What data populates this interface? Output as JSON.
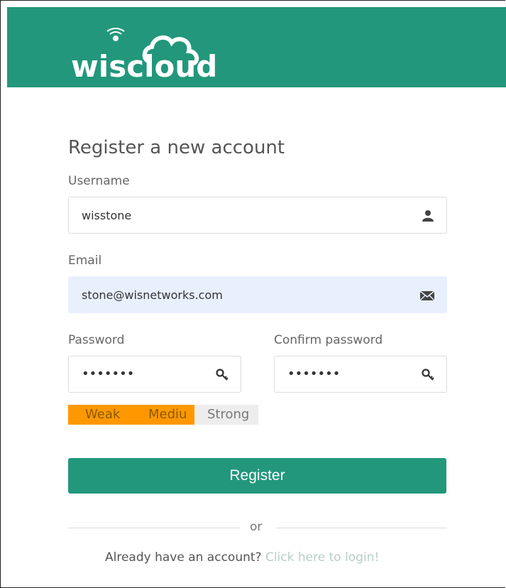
{
  "brand": {
    "logo_text": "wiscloud"
  },
  "form": {
    "title": "Register a new account",
    "username": {
      "label": "Username",
      "value": "wisstone",
      "icon": "user-icon"
    },
    "email": {
      "label": "Email",
      "value": "stone@wisnetworks.com",
      "icon": "envelope-icon"
    },
    "password": {
      "label": "Password",
      "value": "•••••••",
      "icon": "key-icon"
    },
    "confirm_password": {
      "label": "Confirm password",
      "value": "•••••••",
      "icon": "key-icon"
    },
    "strength": {
      "labels": [
        "Weak",
        "Mediu",
        "Strong"
      ],
      "level": "medium",
      "active_color": "#ff9800",
      "inactive_color": "#ededed"
    },
    "register_label": "Register",
    "divider_text": "or",
    "footer_text": "Already have an account?",
    "login_link": "Click here to login!"
  },
  "colors": {
    "primary": "#22977b"
  }
}
